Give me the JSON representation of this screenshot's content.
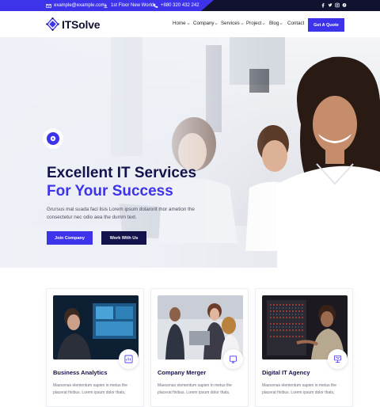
{
  "topbar": {
    "email": "example@example.com",
    "address": "1st Floor New World.",
    "phone": "+880 320 432 242",
    "social_icons": [
      "facebook-icon",
      "twitter-icon",
      "instagram-icon",
      "pinterest-icon"
    ],
    "accent_color": "#3c33ea",
    "background": "#101230"
  },
  "header": {
    "logo_text": "ITSolve",
    "nav": [
      {
        "label": "Home",
        "has_caret": true
      },
      {
        "label": "Company",
        "has_caret": true
      },
      {
        "label": "Services",
        "has_caret": true
      },
      {
        "label": "Project",
        "has_caret": true
      },
      {
        "label": "Blog",
        "has_caret": true
      },
      {
        "label": "Contact",
        "has_caret": false
      }
    ],
    "cta_label": "Get A Quote"
  },
  "hero": {
    "title_line1": "Excellent IT Services",
    "title_line2": "For Your Success",
    "subtitle": "Grursus mal suada faci lisis Lorem ipsum dolarorit mor ametion the consectetur nec odio aea the dumm text.",
    "primary_button": "Join Company",
    "secondary_button": "Work With Us"
  },
  "services": [
    {
      "title": "Business Analytics",
      "text": "Maecenas elementum sapien in metus the placerat finibus. Lorem ipsum dolor thats,",
      "icon": "analytics-icon"
    },
    {
      "title": "Company Merger",
      "text": "Maecenas elementum sapien in metus the placerat finibus. Lorem ipsum dolor thats,",
      "icon": "merger-icon"
    },
    {
      "title": "Digital IT Agency",
      "text": "Maecenas elementum sapien in metus the placerat finibus. Lorem ipsum dolor thats,",
      "icon": "agency-icon"
    }
  ],
  "colors": {
    "brand": "#3c33ea",
    "navy": "#14124a"
  }
}
